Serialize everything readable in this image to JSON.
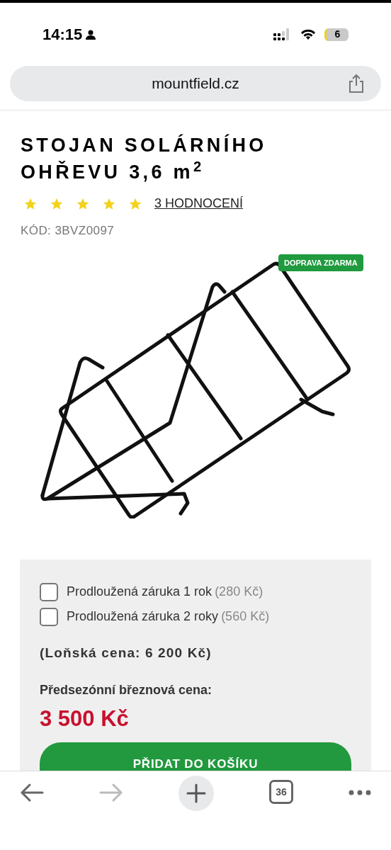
{
  "status_bar": {
    "time": "14:15",
    "battery": "6"
  },
  "address_bar": {
    "url": "mountfield.cz"
  },
  "product": {
    "title": "STOJAN SOLÁRNÍHO OHŘEVU 3,6 m$^{2}$",
    "stars": 5,
    "reviews": "3 HODNOCENÍ",
    "code": "KÓD: 3BVZ0097",
    "badge": "DOPRAVA ZDARMA"
  },
  "purchase": {
    "options": [
      {
        "label": "Prodloužená záruka 1 rok",
        "price": "(280 Kč)",
        "checked": false
      },
      {
        "label": "Prodloužená záruka 2 roky",
        "price": "(560 Kč)",
        "checked": false
      }
    ],
    "last_year_price": "(Loňská cena: 6 200 Kč)",
    "price_label": "Předsezónní březnová cena:",
    "price": "3 500 Kč",
    "add_to_cart": "PŘIDAT DO KOŠÍKU"
  },
  "toolbar": {
    "tabs_count": "36"
  }
}
